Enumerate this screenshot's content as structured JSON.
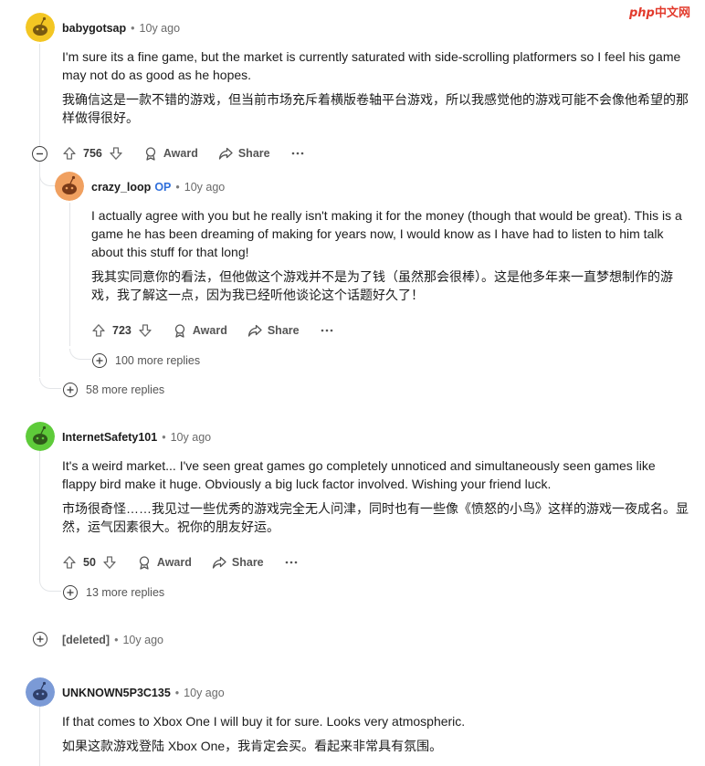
{
  "watermark": "php中文网",
  "comments": [
    {
      "user": "babygotsap",
      "time": "10y ago",
      "avatar_color": "#f3c623",
      "body_en": "I'm sure its a fine game, but the market is currently saturated with side-scrolling platformers so I feel his game may not do as good as he hopes.",
      "body_zh": "我确信这是一款不错的游戏，但当前市场充斥着横版卷轴平台游戏，所以我感觉他的游戏可能不会像他希望的那样做得很好。",
      "votes": "756",
      "award": "Award",
      "share": "Share",
      "more_replies": "58 more replies"
    },
    {
      "user": "crazy_loop",
      "op": "OP",
      "time": "10y ago",
      "avatar_color": "#f0a060",
      "body_en": "I actually agree with you but he really isn't making it for the money (though that would be great). This is a game he has been dreaming of making for years now, I would know as I have had to listen to him talk about this stuff for that long!",
      "body_zh": "我其实同意你的看法，但他做这个游戏并不是为了钱（虽然那会很棒）。这是他多年来一直梦想制作的游戏，我了解这一点，因为我已经听他谈论这个话题好久了！",
      "votes": "723",
      "award": "Award",
      "share": "Share",
      "more_replies": "100 more replies"
    },
    {
      "user": "InternetSafety101",
      "time": "10y ago",
      "avatar_color": "#5ecb3a",
      "body_en": "It's a weird market... I've seen great games go completely unnoticed and simultaneously seen games like flappy bird make it huge. Obviously a big luck factor involved. Wishing your friend luck.",
      "body_zh": "市场很奇怪……我见过一些优秀的游戏完全无人问津，同时也有一些像《愤怒的小鸟》这样的游戏一夜成名。显然，运气因素很大。祝你的朋友好运。",
      "votes": "50",
      "award": "Award",
      "share": "Share",
      "more_replies": "13 more replies"
    },
    {
      "user": "[deleted]",
      "time": "10y ago"
    },
    {
      "user": "UNKNOWN5P3C135",
      "time": "10y ago",
      "avatar_color": "#7b9ad6",
      "body_en": "If that comes to Xbox One I will buy it for sure. Looks very atmospheric.",
      "body_zh": "如果这款游戏登陆 Xbox One，我肯定会买。看起来非常具有氛围。"
    }
  ],
  "icons": {
    "upvote": "upvote-arrow-icon",
    "downvote": "downvote-arrow-icon",
    "award": "award-icon",
    "share": "share-arrow-icon",
    "overflow": "more-dots-icon",
    "collapse": "collapse-minus-icon",
    "expand": "expand-plus-icon"
  }
}
